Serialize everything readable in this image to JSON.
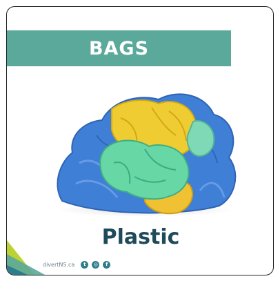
{
  "card": {
    "title": "BAGS",
    "subtitle": "Plastic",
    "image_subject": "crumpled plastic bags (blue, yellow, green)"
  },
  "footer": {
    "url": "divertNS.ca",
    "social_icons": [
      "twitter-icon",
      "instagram-icon",
      "facebook-icon"
    ]
  },
  "colors": {
    "banner": "#5aa99b",
    "subtitle_text": "#1f4a59",
    "bag_blue": "#3f7fd6",
    "bag_yellow": "#f0cc33",
    "bag_green": "#67d7a6",
    "accent_teal": "#2e7d8c",
    "accent_lime": "#bcd233"
  }
}
